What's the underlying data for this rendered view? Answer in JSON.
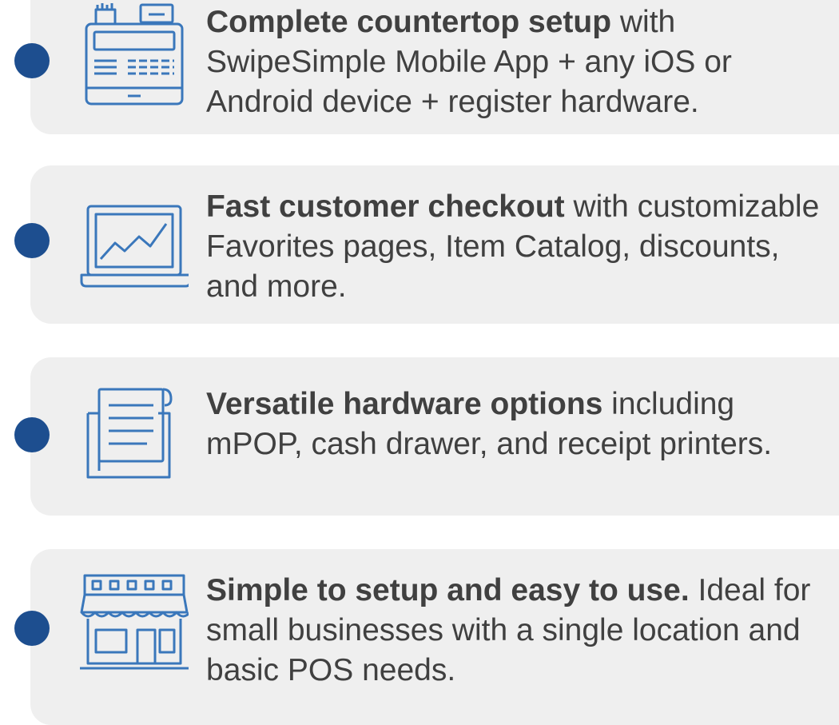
{
  "accent_color": "#1d4e8f",
  "icon_color": "#3a77bb",
  "features": [
    {
      "icon": "cash-register-icon",
      "bold": "Complete countertop setup",
      "rest": " with SwipeSimple Mobile App + any iOS or Android device + register hardware."
    },
    {
      "icon": "laptop-chart-icon",
      "bold": "Fast customer checkout",
      "rest": " with customizable Favorites pages, Item Catalog, discounts, and more."
    },
    {
      "icon": "receipt-printer-icon",
      "bold": "Versatile hardware options",
      "rest": " including mPOP, cash drawer, and receipt printers."
    },
    {
      "icon": "storefront-icon",
      "bold": "Simple to setup and easy to use.",
      "rest": " Ideal for small businesses with a single location and basic POS needs."
    }
  ]
}
